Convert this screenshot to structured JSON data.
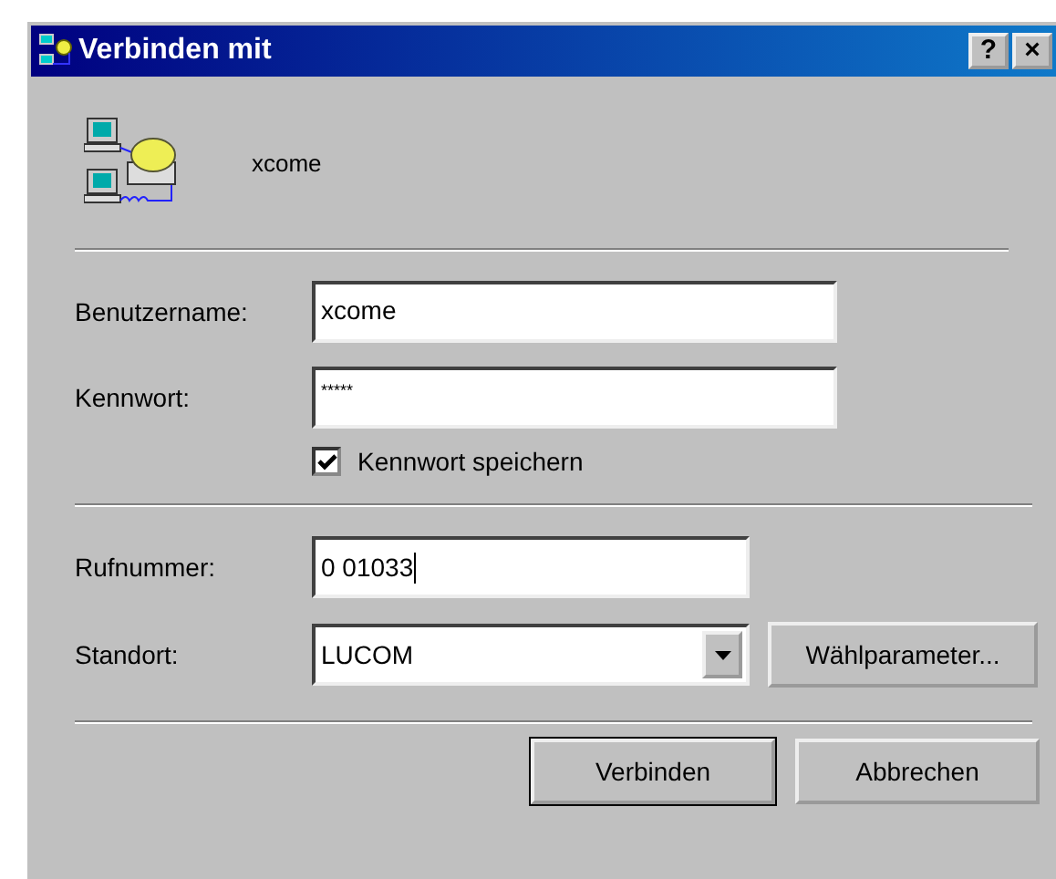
{
  "window": {
    "title": "Verbinden mit"
  },
  "title_buttons": [
    "?",
    "×"
  ],
  "connection": {
    "name": "xcome"
  },
  "fields": [
    {
      "kind": "text",
      "label": "Benutzername:",
      "value": "xcome"
    },
    {
      "kind": "text",
      "label": "Kennwort:",
      "value": "*****"
    }
  ],
  "save_password": {
    "label": "Kennwort speichern",
    "checked": true
  },
  "dial": [
    {
      "kind": "text",
      "label": "Rufnummer:",
      "value": "0 01033"
    },
    {
      "kind": "combo",
      "label": "Standort:",
      "value": "LUCOM",
      "button": "Wählparameter..."
    }
  ],
  "buttons": [
    {
      "label": "Verbinden",
      "default": true
    },
    {
      "label": "Abbrechen",
      "default": false
    }
  ]
}
